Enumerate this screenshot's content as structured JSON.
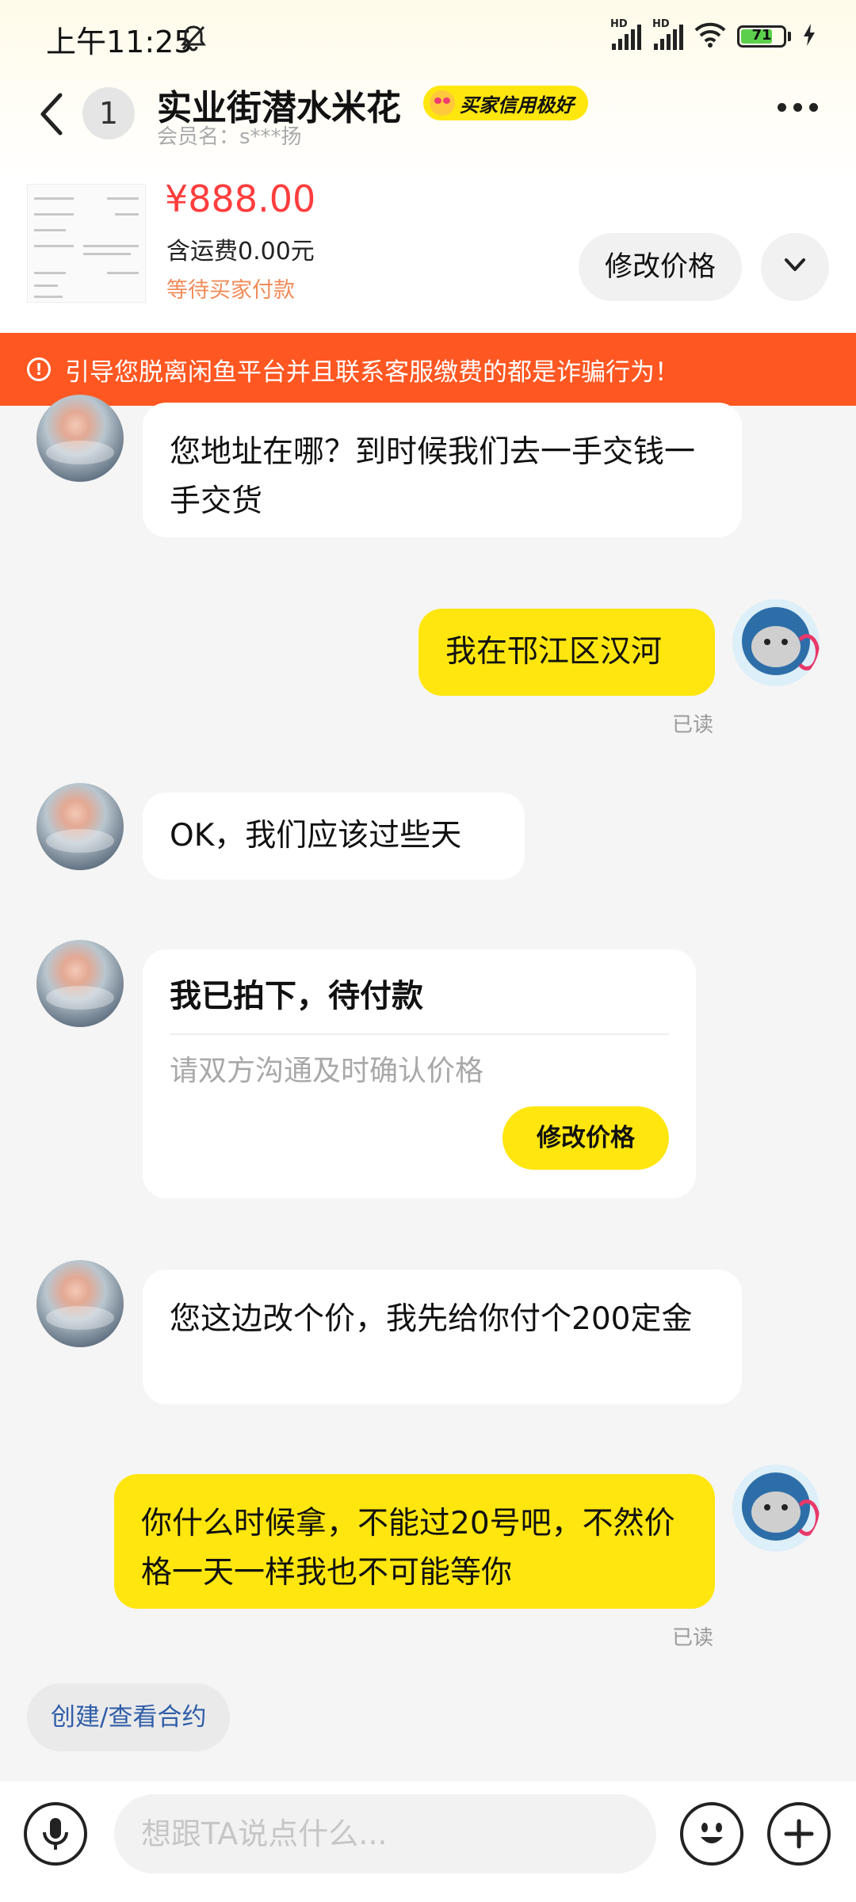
{
  "status_bar": {
    "time": "上午11:25",
    "network_label": "HD",
    "battery_level": "71",
    "battery_color": "#5CD04C"
  },
  "header": {
    "unread_count": "1",
    "title": "实业街潜水米花",
    "credit_badge": "买家信用极好",
    "member_name": "会员名：s***扬"
  },
  "product": {
    "price": "¥888.00",
    "shipping": "含运费0.00元",
    "status": "等待买家付款",
    "modify_price_label": "修改价格"
  },
  "warning": {
    "text": "引导您脱离闲鱼平台并且联系客服缴费的都是诈骗行为！",
    "color": "#FF5722"
  },
  "messages": [
    {
      "side": "in",
      "text": "您地址在哪？到时候我们去一手交钱一手交货"
    },
    {
      "side": "out",
      "text": "我在邗江区汉河",
      "status": "已读"
    },
    {
      "side": "in",
      "text": "OK，我们应该过些天"
    },
    {
      "side": "in",
      "type": "order_card",
      "title": "我已拍下，待付款",
      "subtitle": "请双方沟通及时确认价格",
      "button": "修改价格"
    },
    {
      "side": "in",
      "text": "您这边改个价，我先给你付个200定金"
    },
    {
      "side": "out",
      "text": "你什么时候拿，不能过20号吧，不然价格一天一样我也不可能等你",
      "status": "已读"
    }
  ],
  "quick_action": {
    "label": "创建/查看合约"
  },
  "input_bar": {
    "placeholder": "想跟TA说点什么..."
  },
  "colors": {
    "accent_yellow": "#FFE60F",
    "price_red": "#FF3D3D",
    "link_blue": "#2F5DA8"
  }
}
